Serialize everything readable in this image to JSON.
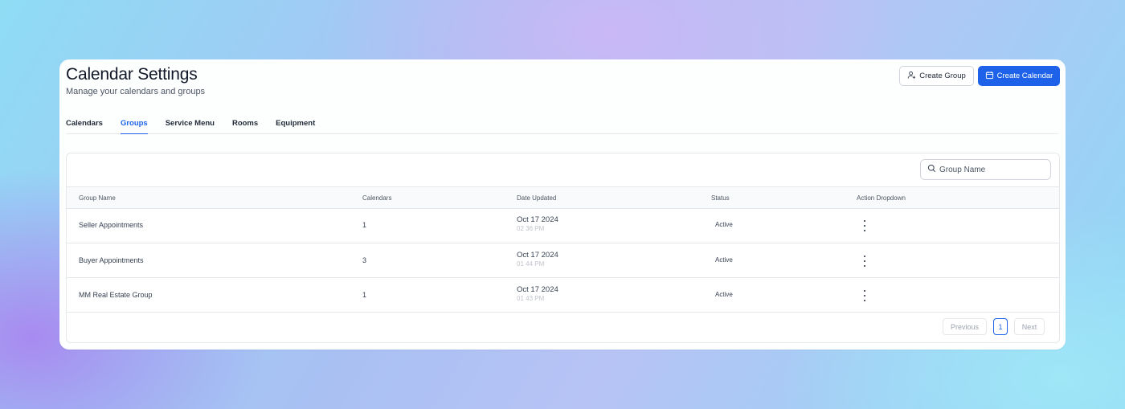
{
  "header": {
    "title": "Calendar Settings",
    "subtitle": "Manage your calendars and groups",
    "create_group_label": "Create Group",
    "create_calendar_label": "Create Calendar"
  },
  "tabs": [
    {
      "label": "Calendars",
      "active": false
    },
    {
      "label": "Groups",
      "active": true
    },
    {
      "label": "Service Menu",
      "active": false
    },
    {
      "label": "Rooms",
      "active": false
    },
    {
      "label": "Equipment",
      "active": false
    }
  ],
  "search": {
    "placeholder": "Group Name",
    "icon": "search-icon"
  },
  "table": {
    "columns": [
      "Group Name",
      "Calendars",
      "Date Updated",
      "Status",
      "Action Dropdown"
    ],
    "rows": [
      {
        "name": "Seller Appointments",
        "calendars": "1",
        "date": "Oct 17 2024",
        "time": "02 36 PM",
        "status": "Active"
      },
      {
        "name": "Buyer Appointments",
        "calendars": "3",
        "date": "Oct 17 2024",
        "time": "01 44 PM",
        "status": "Active"
      },
      {
        "name": "MM Real Estate Group",
        "calendars": "1",
        "date": "Oct 17 2024",
        "time": "01 43 PM",
        "status": "Active"
      }
    ]
  },
  "pagination": {
    "previous_label": "Previous",
    "current_page": "1",
    "next_label": "Next"
  },
  "colors": {
    "accent": "#1d62e8",
    "text": "#111827",
    "border": "#e5e7eb"
  }
}
